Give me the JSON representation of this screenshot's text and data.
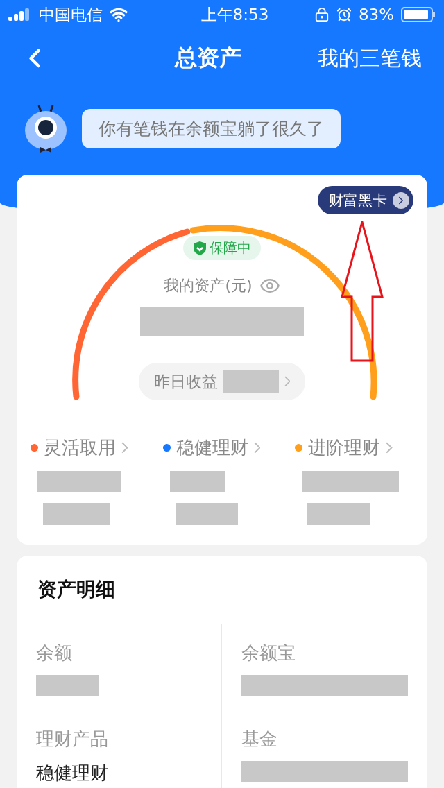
{
  "status_bar": {
    "carrier": "中国电信",
    "time": "上午8:53",
    "battery": "83%"
  },
  "nav": {
    "title": "总资产",
    "action": "我的三笔钱"
  },
  "tip": {
    "text": "你有笔钱在余额宝躺了很久了"
  },
  "summary": {
    "badge": "财富黑卡",
    "status": "保障中",
    "label": "我的资产(元)",
    "yesterday_label": "昨日收益"
  },
  "categories": [
    {
      "label": "灵活取用",
      "color": "#ff6633"
    },
    {
      "label": "稳健理财",
      "color": "#1677ff"
    },
    {
      "label": "进阶理财",
      "color": "#ff9f1c"
    }
  ],
  "details": {
    "title": "资产明细",
    "items": [
      {
        "label": "余额"
      },
      {
        "label": "余额宝"
      },
      {
        "label": "理财产品",
        "value": "稳健理财"
      },
      {
        "label": "基金"
      }
    ]
  }
}
